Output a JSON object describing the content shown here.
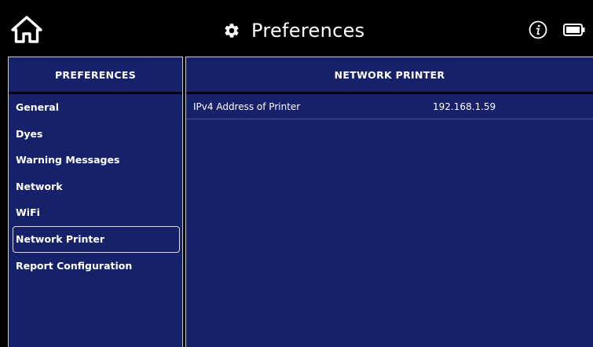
{
  "header": {
    "title": "Preferences",
    "home_icon": "home-icon",
    "settings_icon": "gear-icon",
    "info_icon": "info-icon",
    "battery_icon": "battery-icon"
  },
  "sidebar": {
    "header": "PREFERENCES",
    "items": [
      {
        "label": "General",
        "active": false
      },
      {
        "label": "Dyes",
        "active": false
      },
      {
        "label": "Warning Messages",
        "active": false
      },
      {
        "label": "Network",
        "active": false
      },
      {
        "label": "WiFi",
        "active": false
      },
      {
        "label": "Network Printer",
        "active": true
      },
      {
        "label": "Report Configuration",
        "active": false
      }
    ]
  },
  "content": {
    "header": "NETWORK PRINTER",
    "rows": [
      {
        "label": "IPv4 Address of Printer",
        "value": "192.168.1.59"
      }
    ]
  },
  "colors": {
    "panel_bg": "#17216a",
    "background": "#000000",
    "text": "#ffffff",
    "border": "#c8ccd8"
  }
}
